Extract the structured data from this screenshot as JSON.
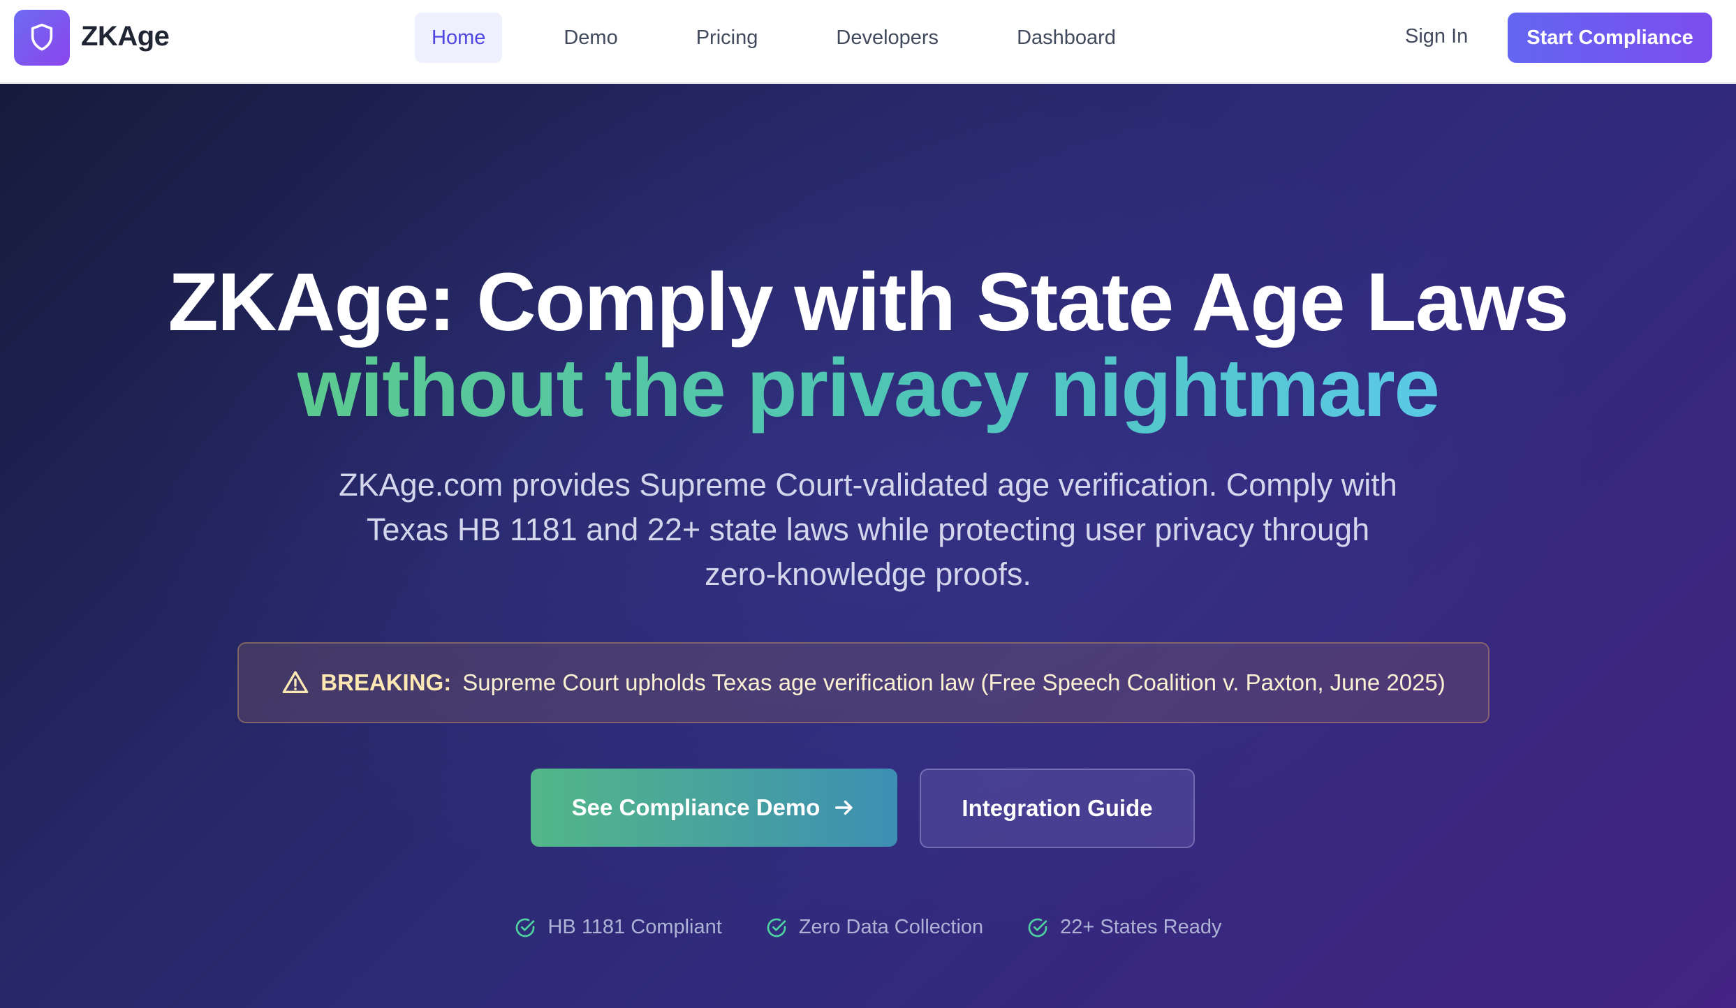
{
  "brand": {
    "name": "ZKAge"
  },
  "nav": {
    "items": [
      {
        "label": "Home",
        "active": true
      },
      {
        "label": "Demo",
        "active": false
      },
      {
        "label": "Pricing",
        "active": false
      },
      {
        "label": "Developers",
        "active": false
      },
      {
        "label": "Dashboard",
        "active": false
      }
    ],
    "sign_in": "Sign In",
    "cta": "Start Compliance"
  },
  "hero": {
    "title_line1": "ZKAge: Comply with State Age Laws",
    "title_line2": "without the privacy nightmare",
    "subtitle": "ZKAge.com provides Supreme Court-validated age verification. Comply with Texas HB 1181 and 22+ state laws while protecting user privacy through zero-knowledge proofs.",
    "alert": {
      "label": "BREAKING:",
      "message": "Supreme Court upholds Texas age verification law (Free Speech Coalition v. Paxton, June 2025)"
    },
    "primary_button": "See Compliance Demo",
    "secondary_button": "Integration Guide",
    "badges": [
      "HB 1181 Compliant",
      "Zero Data Collection",
      "22+ States Ready"
    ]
  },
  "colors": {
    "accent": "#6366f1",
    "accent_purple": "#7c4dee",
    "green": "#52b788",
    "hero_bg": "#27286a",
    "check_green": "#4fd1a1"
  },
  "icons": {
    "logo": "shield-icon",
    "alert": "warning-icon",
    "arrow": "arrow-right-icon",
    "badge": "check-circle-icon"
  }
}
